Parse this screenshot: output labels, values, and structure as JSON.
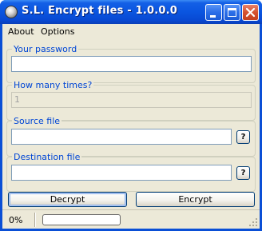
{
  "window": {
    "title": "S.L. Encrypt files - 1.0.0.0"
  },
  "menu": {
    "about": "About",
    "options": "Options"
  },
  "password": {
    "label": "Your password",
    "value": ""
  },
  "times": {
    "label": "How many times?",
    "value": "1"
  },
  "source": {
    "label": "Source file",
    "value": "",
    "browse_label": "?"
  },
  "destination": {
    "label": "Destination file",
    "value": "",
    "browse_label": "?"
  },
  "actions": {
    "decrypt_label": "Decrypt",
    "encrypt_label": "Encrypt"
  },
  "status": {
    "percent_text": "0%",
    "progress": 0
  },
  "colors": {
    "titlebar": "#0a55e0",
    "group_label": "#0046d5",
    "progress_fill": "#2fbe2f"
  },
  "icons": {
    "app": "app-icon",
    "minimize": "minimize-icon",
    "maximize": "maximize-icon",
    "close": "close-icon"
  }
}
